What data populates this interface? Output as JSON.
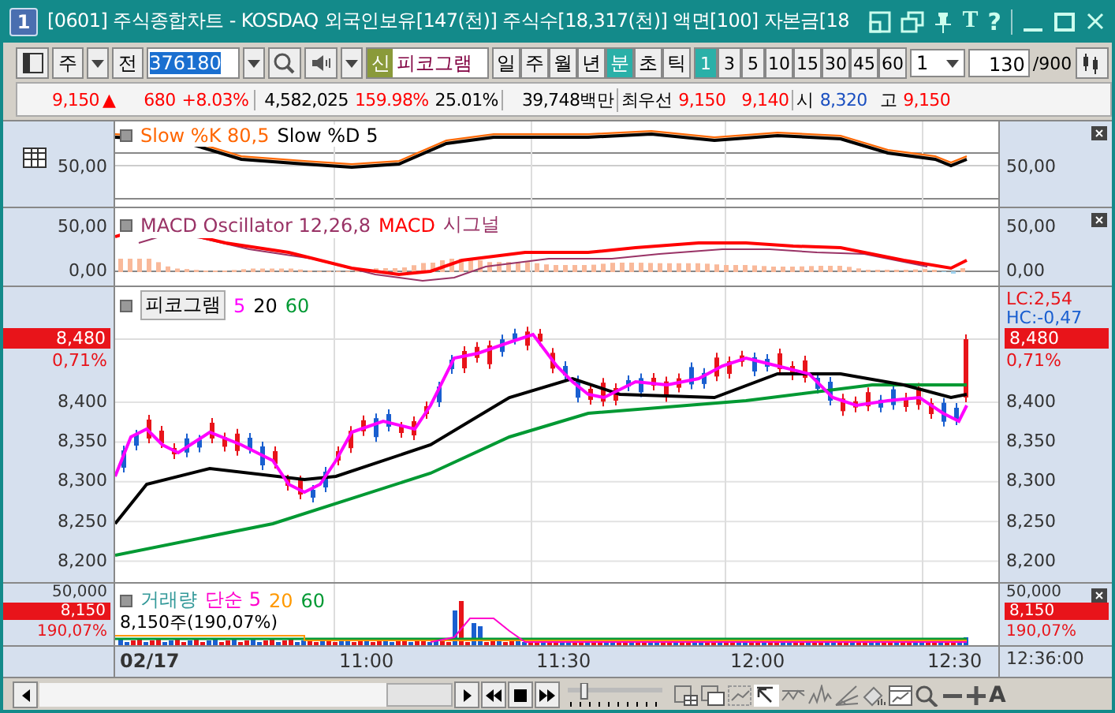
{
  "window": {
    "number": "1",
    "title": "[0601] 주식종합차트 - KOSDAQ 외국인보유[147(천)] 주식수[18,317(천)] 액면[100] 자본금[18",
    "text_buttons": [
      "T",
      "?"
    ]
  },
  "toolbar": {
    "market": "주",
    "prev_button": "전",
    "code": "376180",
    "item_tag": "신",
    "item_name": "피코그램",
    "periods": [
      {
        "label": "일",
        "selected": false
      },
      {
        "label": "주",
        "selected": false
      },
      {
        "label": "월",
        "selected": false
      },
      {
        "label": "년",
        "selected": false
      },
      {
        "label": "분",
        "selected": true
      },
      {
        "label": "초",
        "selected": false
      },
      {
        "label": "틱",
        "selected": false
      }
    ],
    "intervals": [
      {
        "label": "1",
        "selected": true
      },
      {
        "label": "3",
        "selected": false
      },
      {
        "label": "5",
        "selected": false
      },
      {
        "label": "10",
        "selected": false
      },
      {
        "label": "15",
        "selected": false
      },
      {
        "label": "30",
        "selected": false
      },
      {
        "label": "45",
        "selected": false
      },
      {
        "label": "60",
        "selected": false
      }
    ],
    "multiplier": "1",
    "count": "130",
    "count_max": "/900"
  },
  "quote": [
    {
      "text": "9,150",
      "color": "#ff0000"
    },
    {
      "text": "▲",
      "color": "#ff0000"
    },
    {
      "text": "680",
      "color": "#ff0000"
    },
    {
      "text": "+8.03%",
      "color": "#ff0000"
    },
    {
      "text": "4,582,025",
      "color": "#000000"
    },
    {
      "text": "159.98%",
      "color": "#ff0000"
    },
    {
      "text": "25.01%",
      "color": "#000000"
    },
    {
      "text": "39,748백만",
      "color": "#000000"
    },
    {
      "text": "최우선",
      "color": "#000000"
    },
    {
      "text": "9,150",
      "color": "#ff0000"
    },
    {
      "text": "9,140",
      "color": "#ff0000"
    },
    {
      "text": "시",
      "color": "#000000"
    },
    {
      "text": "8,320",
      "color": "#1a4fc0"
    },
    {
      "text": "고",
      "color": "#000000"
    },
    {
      "text": "9,150",
      "color": "#ff0000"
    }
  ],
  "stochastic": {
    "legend": [
      {
        "text": "Slow %K 80,5",
        "color": "#ff6600"
      },
      {
        "text": "Slow %D 5",
        "color": "#000000"
      }
    ],
    "left_ticks": [
      "50,00"
    ],
    "right_ticks": [
      "50,00"
    ]
  },
  "macd": {
    "legend": [
      {
        "text": "MACD Oscillator 12,26,8",
        "color": "#993366"
      },
      {
        "text": "MACD",
        "color": "#ff0000"
      },
      {
        "text": "시그널",
        "color": "#993366"
      }
    ],
    "left_ticks": [
      "50,00",
      "0,00"
    ],
    "right_ticks": [
      "50,00",
      "0,00"
    ]
  },
  "price": {
    "legend": [
      {
        "text": "피코그램",
        "color": "#000000"
      },
      {
        "text": "5",
        "color": "#ff00ff"
      },
      {
        "text": "20",
        "color": "#000000"
      },
      {
        "text": "60",
        "color": "#009933"
      }
    ],
    "left": {
      "tag": "8,480",
      "change": "0,71%"
    },
    "right": {
      "lc": "LC:2,54",
      "hc": "HC:-0,47",
      "tag": "8,480",
      "change": "0,71%"
    },
    "left_ticks": [
      "8,400",
      "8,350",
      "8,300",
      "8,250",
      "8,200"
    ],
    "right_ticks": [
      "8,400",
      "8,350",
      "8,300",
      "8,250",
      "8,200"
    ]
  },
  "volume": {
    "legend": [
      {
        "text": "거래량",
        "color": "#339999"
      },
      {
        "text": "단순 5",
        "color": "#ff00cc"
      },
      {
        "text": "20",
        "color": "#ff9900"
      },
      {
        "text": "60",
        "color": "#009933"
      }
    ],
    "info": "8,150주(190,07%)",
    "left": {
      "tick": "50,000",
      "tag": "8,150",
      "change": "190,07%"
    },
    "right": {
      "tick": "50,000",
      "tag": "8,150",
      "change": "190,07%"
    }
  },
  "time_axis": {
    "labels": [
      "02/17",
      "11:00",
      "11:30",
      "12:00",
      "12:30"
    ],
    "current": "12:36:00"
  },
  "footer": {
    "font_button": "A",
    "zoom_slider": {
      "level": 0.15
    }
  }
}
